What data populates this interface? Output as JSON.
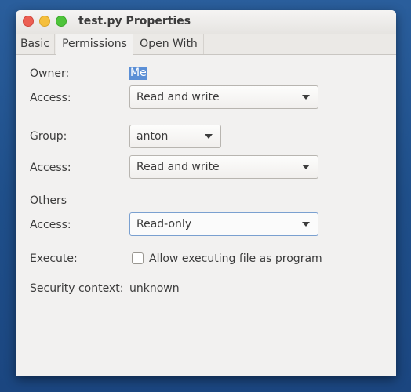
{
  "window": {
    "title": "test.py Properties"
  },
  "tabs": [
    {
      "label": "Basic"
    },
    {
      "label": "Permissions"
    },
    {
      "label": "Open With"
    }
  ],
  "permissions": {
    "owner_label": "Owner:",
    "owner_value": "Me",
    "owner_access_label": "Access:",
    "owner_access_value": "Read and write",
    "group_label": "Group:",
    "group_value": "anton",
    "group_access_label": "Access:",
    "group_access_value": "Read and write",
    "others_heading": "Others",
    "others_access_label": "Access:",
    "others_access_value": "Read-only",
    "execute_label": "Execute:",
    "execute_checkbox_label": "Allow executing file as program",
    "execute_checked": false,
    "security_label": "Security context:",
    "security_value": "unknown"
  },
  "colors": {
    "desktop": "#1f4f8a",
    "selection": "#5b8fd6",
    "close": "#ec5f53",
    "minimize": "#f5bf3c",
    "maximize": "#4fc43b"
  }
}
